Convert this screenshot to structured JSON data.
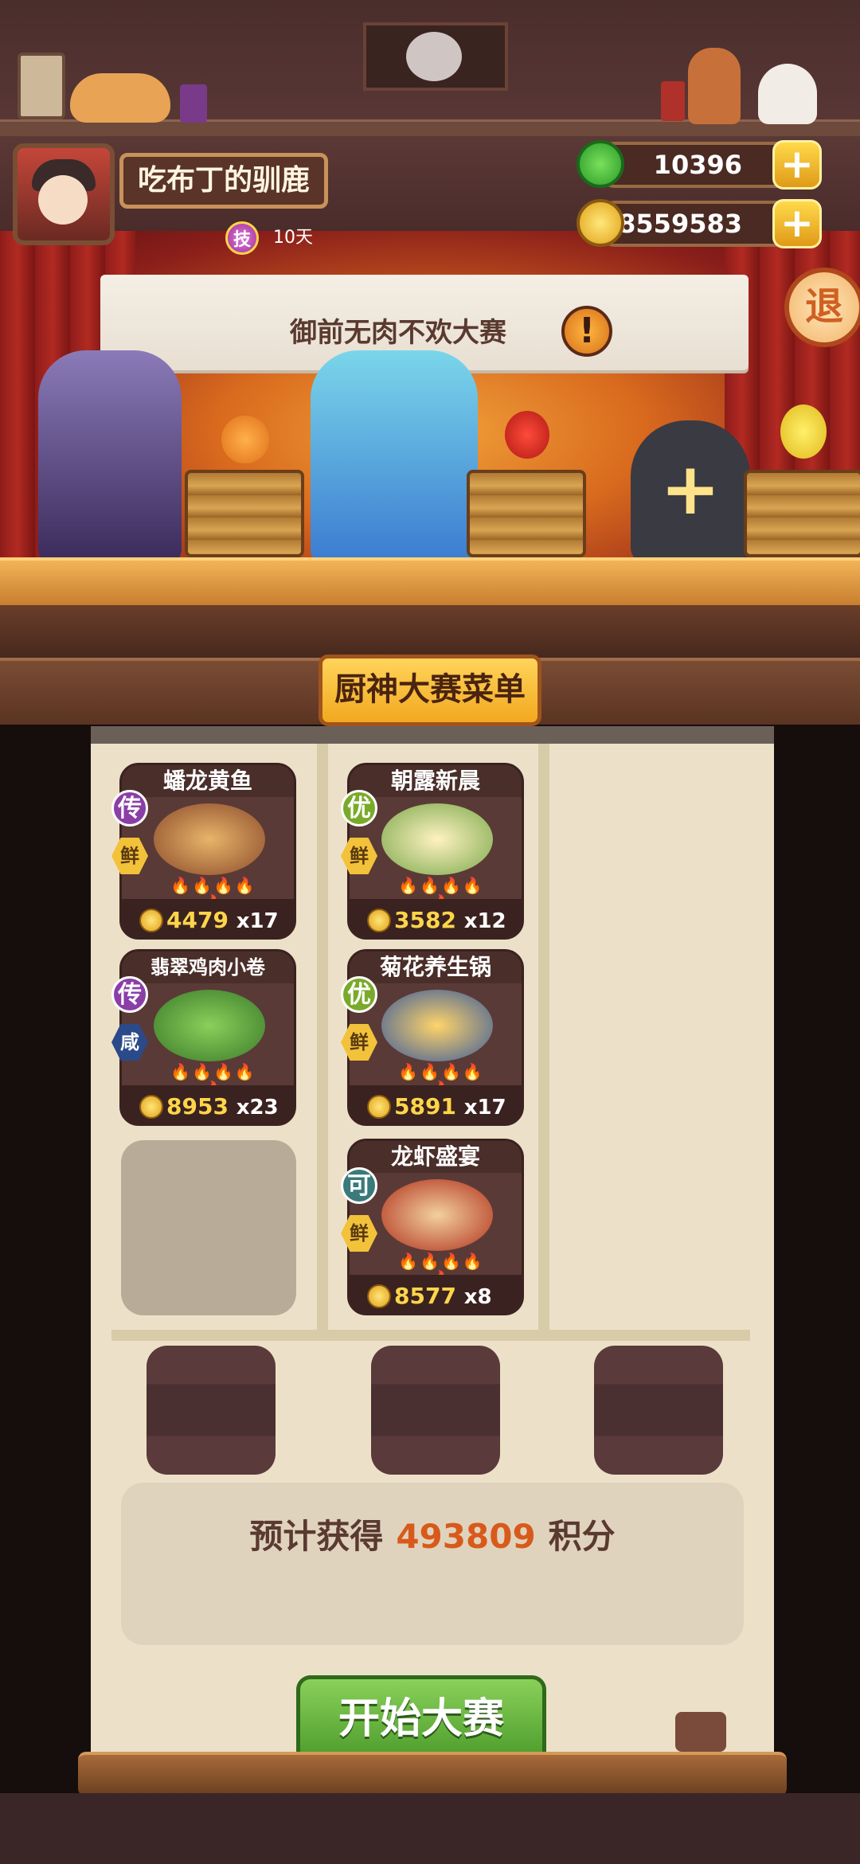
{
  "profile": {
    "name": "吃布丁的驯鹿",
    "skill_icon_label": "技",
    "skill_days": "10天"
  },
  "currency": {
    "gems": "10396",
    "coins": "68559583",
    "plus": "+"
  },
  "exit_label": "退",
  "contest": {
    "banner_title": "御前无肉不欢大赛",
    "alert_icon": "!"
  },
  "stage": {
    "empty_slot_plus": "+"
  },
  "menu": {
    "title": "厨神大赛菜单",
    "columns": [
      [
        {
          "name": "蟠龙黄鱼",
          "grade": "传",
          "flavor": "鲜",
          "price": "4479",
          "qty": "x17",
          "grade_color": "#8a3ea6",
          "flavor_color": "#f2c23a"
        },
        {
          "name": "翡翠鸡肉小卷",
          "grade": "传",
          "flavor": "咸",
          "price": "8953",
          "qty": "x23",
          "grade_color": "#8a3ea6",
          "flavor_color": "#2a4a8a"
        }
      ],
      [
        {
          "name": "朝露新晨",
          "grade": "优",
          "flavor": "鲜",
          "price": "3582",
          "qty": "x12",
          "grade_color": "#7aaa2a",
          "flavor_color": "#f2c23a"
        },
        {
          "name": "菊花养生锅",
          "grade": "优",
          "flavor": "鲜",
          "price": "5891",
          "qty": "x17",
          "grade_color": "#7aaa2a",
          "flavor_color": "#f2c23a"
        },
        {
          "name": "龙虾盛宴",
          "grade": "可",
          "flavor": "鲜",
          "price": "8577",
          "qty": "x8",
          "grade_color": "#3a7a7a",
          "flavor_color": "#f2c23a"
        }
      ]
    ]
  },
  "estimate": {
    "prefix": "预计获得",
    "points": "493809",
    "suffix": "积分"
  },
  "start_button": "开始大赛",
  "colors": {
    "accent_orange": "#d85a1a",
    "start_green": "#4a9a2a",
    "gold": "#f2a820"
  }
}
